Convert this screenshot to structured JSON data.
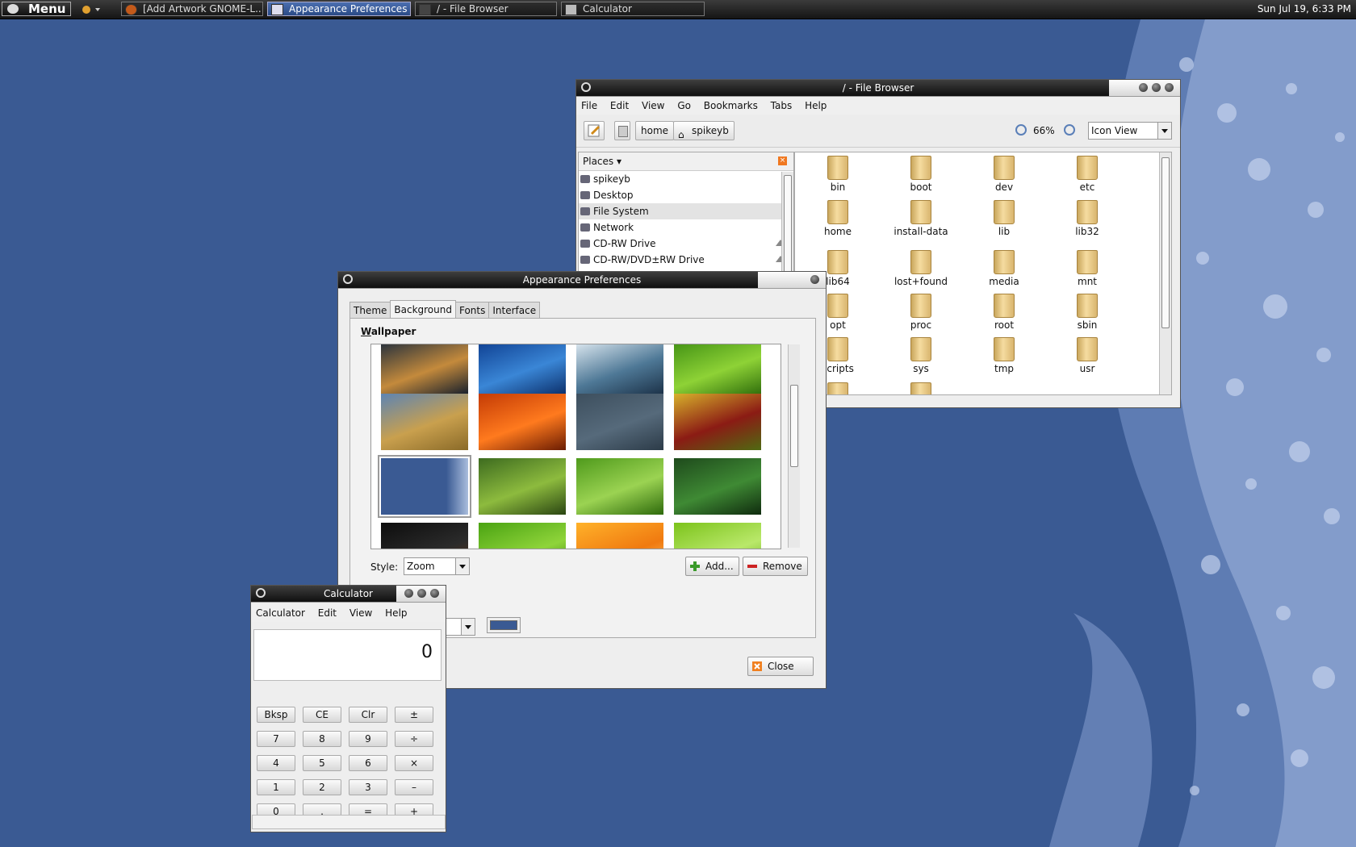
{
  "panel": {
    "menu_label": "Menu",
    "tasks": [
      {
        "label": "[Add Artwork GNOME-L...",
        "active": false
      },
      {
        "label": "Appearance Preferences",
        "active": true
      },
      {
        "label": "/ - File Browser",
        "active": false
      },
      {
        "label": "Calculator",
        "active": false
      }
    ],
    "clock": "Sun Jul 19,  6:33 PM"
  },
  "file_browser": {
    "title": "/ - File Browser",
    "menu": [
      "File",
      "Edit",
      "View",
      "Go",
      "Bookmarks",
      "Tabs",
      "Help"
    ],
    "path": [
      "home",
      "spikeyb"
    ],
    "zoom": "66%",
    "view_mode": "Icon View",
    "places_header": "Places",
    "places": [
      {
        "label": "spikeyb",
        "icon": "home-icon",
        "selected": false,
        "eject": false
      },
      {
        "label": "Desktop",
        "icon": "desktop-icon",
        "selected": false,
        "eject": false
      },
      {
        "label": "File System",
        "icon": "harddisk-icon",
        "selected": true,
        "eject": false
      },
      {
        "label": "Network",
        "icon": "network-icon",
        "selected": false,
        "eject": false
      },
      {
        "label": "CD-RW Drive",
        "icon": "optical-drive-icon",
        "selected": false,
        "eject": true
      },
      {
        "label": "CD-RW/DVD±RW Drive",
        "icon": "optical-drive-icon",
        "selected": false,
        "eject": true
      }
    ],
    "items": [
      "bin",
      "boot",
      "dev",
      "etc",
      "home",
      "install-data",
      "lib",
      "lib32",
      "lib64",
      "lost+found",
      "media",
      "mnt",
      "opt",
      "proc",
      "root",
      "sbin",
      "scripts",
      "sys",
      "tmp",
      "usr"
    ]
  },
  "appearance": {
    "title": "Appearance Preferences",
    "tabs": [
      "Theme",
      "Background",
      "Fonts",
      "Interface"
    ],
    "active_tab": "Background",
    "section_label": "Wallpaper",
    "style_label": "Style:",
    "style_value": "Zoom",
    "add_label": "Add...",
    "remove_label": "Remove",
    "close_label": "Close",
    "color_swatch": "#3a5a93",
    "wallpapers": [
      {
        "name": "coast-dusk",
        "colors": [
          "#1c2b3d",
          "#c48a3c",
          "#0e1a2b"
        ]
      },
      {
        "name": "blue-orbs",
        "colors": [
          "#0d3d8f",
          "#3a86d6",
          "#0a2c66"
        ]
      },
      {
        "name": "water-drop",
        "colors": [
          "#e4eef5",
          "#4e7896",
          "#1a2f45"
        ]
      },
      {
        "name": "green-leaf",
        "colors": [
          "#3f8f13",
          "#8ed236",
          "#2c6a0a"
        ]
      },
      {
        "name": "grass-beach",
        "colors": [
          "#5d84b3",
          "#c9a04e",
          "#8a6a28"
        ]
      },
      {
        "name": "orange-flower",
        "colors": [
          "#c43b05",
          "#ff7a1e",
          "#6a1c02"
        ]
      },
      {
        "name": "blue-gray-bubbles",
        "colors": [
          "#3d4f5e",
          "#566a7b",
          "#2c3b48"
        ]
      },
      {
        "name": "red-marigold",
        "colors": [
          "#d7b12b",
          "#8b1b14",
          "#4f6a12"
        ]
      },
      {
        "name": "blue-waves",
        "colors": [
          "#3a5a93",
          "#3a5a93",
          "#a9bddd"
        ]
      },
      {
        "name": "green-sprouts",
        "colors": [
          "#3d6b1f",
          "#8dbb3e",
          "#2a4512"
        ]
      },
      {
        "name": "grass-blades",
        "colors": [
          "#4f9a1c",
          "#9bd352",
          "#2e6a0c"
        ]
      },
      {
        "name": "dark-leaf",
        "colors": [
          "#1e4a1c",
          "#3f8a34",
          "#0f2b0e"
        ]
      },
      {
        "name": "dark-swirl",
        "colors": [
          "#0d0d0d",
          "#2b2b2b",
          "#6a3a1a"
        ]
      },
      {
        "name": "green-abstract",
        "colors": [
          "#4aa312",
          "#8fd43a",
          "#2d7208"
        ]
      },
      {
        "name": "orange-abstract",
        "colors": [
          "#ffb22a",
          "#f07a10",
          "#ffd070"
        ]
      },
      {
        "name": "lime-abstract",
        "colors": [
          "#7cc31b",
          "#b9e86a",
          "#5aa00f"
        ]
      }
    ]
  },
  "calculator": {
    "title": "Calculator",
    "menu": [
      "Calculator",
      "Edit",
      "View",
      "Help"
    ],
    "display": "0",
    "keys": [
      [
        "Bksp",
        "CE",
        "Clr",
        "±"
      ],
      [
        "7",
        "8",
        "9",
        "÷"
      ],
      [
        "4",
        "5",
        "6",
        "×"
      ],
      [
        "1",
        "2",
        "3",
        "–"
      ],
      [
        "0",
        ".",
        "=",
        "+"
      ]
    ]
  }
}
